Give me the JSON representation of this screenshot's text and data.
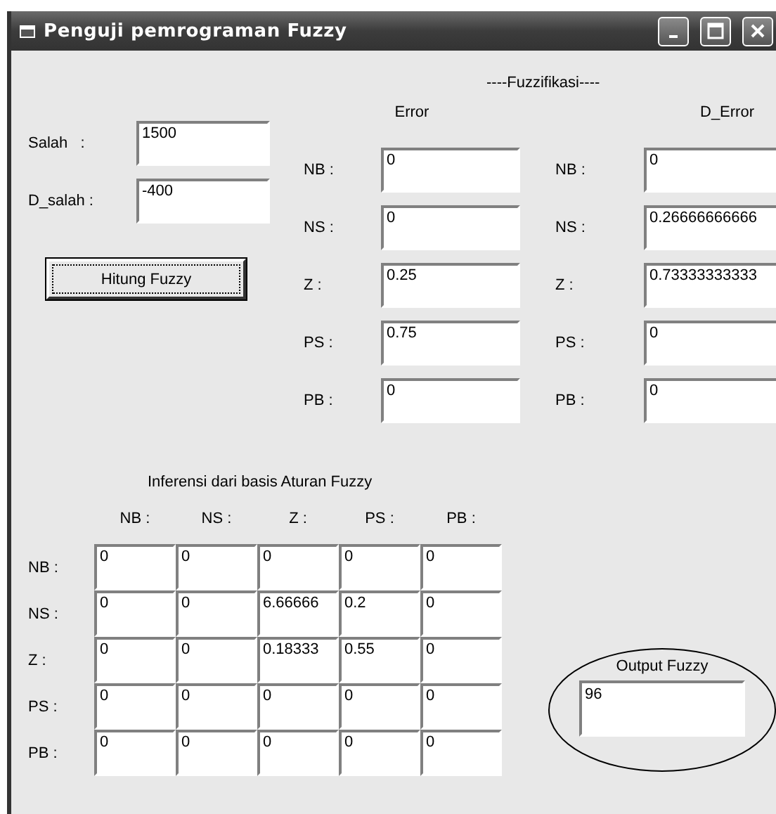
{
  "window": {
    "title": "Penguji pemrograman Fuzzy"
  },
  "inputs": [
    {
      "label": "Salah   :",
      "value": "1500"
    },
    {
      "label": "D_salah :",
      "value": "-400"
    }
  ],
  "button": {
    "label": "Hitung Fuzzy",
    "focused": true
  },
  "fuzzification": {
    "title": "----Fuzzifikasi----",
    "columns": [
      {
        "heading": "Error",
        "rows": [
          {
            "label": "NB :",
            "value": "0"
          },
          {
            "label": "NS :",
            "value": "0"
          },
          {
            "label": "Z :",
            "value": "0.25"
          },
          {
            "label": "PS :",
            "value": "0.75"
          },
          {
            "label": "PB :",
            "value": "0"
          }
        ]
      },
      {
        "heading": "D_Error",
        "rows": [
          {
            "label": "NB :",
            "value": "0"
          },
          {
            "label": "NS :",
            "value": "0.26666666666"
          },
          {
            "label": "Z :",
            "value": "0.73333333333"
          },
          {
            "label": "PS :",
            "value": "0"
          },
          {
            "label": "PB :",
            "value": "0"
          }
        ]
      }
    ]
  },
  "inference": {
    "title": "Inferensi dari basis Aturan Fuzzy",
    "column_headers": [
      "NB :",
      "NS :",
      "Z :",
      "PS :",
      "PB :"
    ],
    "rows": [
      {
        "label": "NB :",
        "cells": [
          "0",
          "0",
          "0",
          "0",
          "0"
        ]
      },
      {
        "label": "NS :",
        "cells": [
          "0",
          "0",
          "6.66666",
          "0.2",
          "0"
        ]
      },
      {
        "label": "Z :",
        "cells": [
          "0",
          "0",
          "0.18333",
          "0.55",
          "0"
        ]
      },
      {
        "label": "PS :",
        "cells": [
          "0",
          "0",
          "0",
          "0",
          "0"
        ]
      },
      {
        "label": "PB :",
        "cells": [
          "0",
          "0",
          "0",
          "0",
          "0"
        ]
      }
    ]
  },
  "output": {
    "label": "Output Fuzzy",
    "value": "96"
  }
}
